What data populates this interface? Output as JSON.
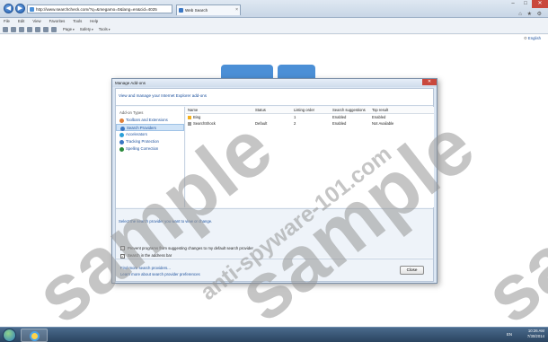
{
  "browser": {
    "address": "http://www.searchcheck.com/?q=&megamo=0&lang=en&cid=4025",
    "tab_title": "Web Search",
    "tab_close": "×",
    "back": "◀",
    "forward": "▶",
    "menu": [
      "File",
      "Edit",
      "View",
      "Favorites",
      "Tools",
      "Help"
    ],
    "command_menus": [
      "Page",
      "Safety",
      "Tools"
    ],
    "window_controls": {
      "minimize": "–",
      "maximize": "□",
      "close": "✕"
    },
    "toolbar_icons": "⌂ ★ ⚙",
    "page_link": "English"
  },
  "dialog": {
    "title": "Manage Add-ons",
    "header": "View and manage your Internet Explorer add-ons",
    "addon_types_title": "Add-on Types",
    "addon_types": [
      {
        "label": "Toolbars and Extensions",
        "icon": "gear-icon",
        "color": "#e0803a"
      },
      {
        "label": "Search Providers",
        "icon": "search-icon",
        "color": "#3a77c4"
      },
      {
        "label": "Accelerators",
        "icon": "accelerator-icon",
        "color": "#2aa0d8"
      },
      {
        "label": "Tracking Protection",
        "icon": "shield-icon",
        "color": "#3a77c4"
      },
      {
        "label": "Spelling Correction",
        "icon": "spelling-icon",
        "color": "#2a8a3a"
      }
    ],
    "columns": [
      "Name",
      "Status",
      "Listing order",
      "Search suggestions",
      "Top result"
    ],
    "rows": [
      {
        "name": "Bing",
        "status": "",
        "order": "1",
        "suggestions": "Enabled",
        "top": "Enabled",
        "icon_color": "#f2b01e"
      },
      {
        "name": "SearchShock",
        "status": "Default",
        "order": "2",
        "suggestions": "Enabled",
        "top": "Not Available",
        "icon_color": "#9a9a9a"
      }
    ],
    "detail_hint": "Select the search provider you want to view or change.",
    "checkbox_prevent": "Prevent programs from suggesting changes to my default search provider",
    "checkbox_search": "Search in the address bar",
    "link_find": "Find more search providers...",
    "link_learn": "Learn more about search provider preferences",
    "close_label": "Close",
    "close_x": "✕"
  },
  "taskbar": {
    "lang": "EN",
    "time": "10:26 AM",
    "date": "7/30/2014"
  },
  "watermark": {
    "main": "sample",
    "site": "anti-spyware-101.com"
  }
}
